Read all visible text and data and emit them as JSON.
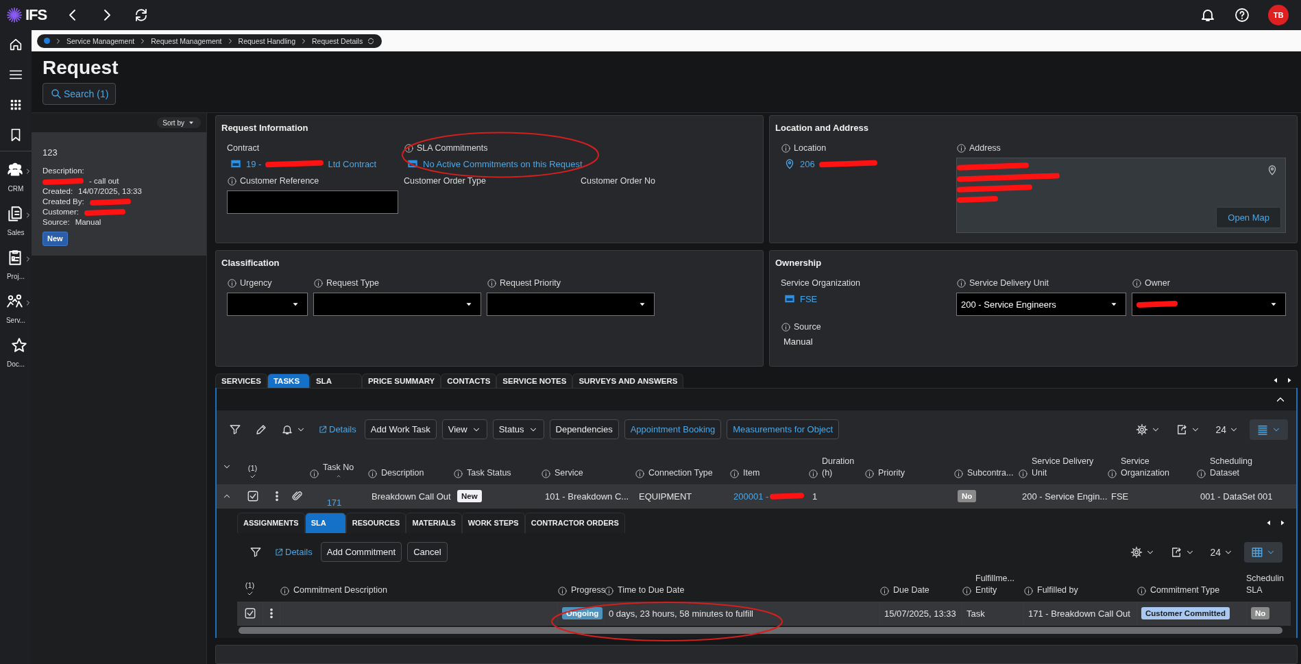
{
  "topbar": {
    "logo": "IFS",
    "avatar": "TB"
  },
  "nav": [
    {
      "kind": "crm",
      "label": "CRM",
      "expandable": true
    },
    {
      "kind": "sales",
      "label": "Sales",
      "expandable": true
    },
    {
      "kind": "proj",
      "label": "Proj...",
      "expandable": true
    },
    {
      "kind": "serv",
      "label": "Serv...",
      "expandable": true
    },
    {
      "kind": "doc",
      "label": "Doc...",
      "expandable": false
    }
  ],
  "breadcrumb": [
    "Service Management",
    "Request Management",
    "Request Handling",
    "Request Details"
  ],
  "title": "Request",
  "search_button": "Search (1)",
  "list": {
    "sort": "Sort by",
    "cards": [
      {
        "selected": true,
        "title": "123",
        "status": "New",
        "lines": [
          {
            "label": "Description:"
          },
          {
            "value": "- call out",
            "redacted": true
          },
          {
            "label": "Created:",
            "value": "14/07/2025, 13:33"
          },
          {
            "label": "Created By:",
            "redacted": true
          },
          {
            "label": "Customer:",
            "redacted": true
          },
          {
            "label": "Source:",
            "value": "Manual"
          }
        ]
      }
    ]
  },
  "panels": [
    {
      "title": "Request Information",
      "rows": [
        [
          {
            "kind": "link",
            "label": "Contract",
            "info": false,
            "parts": [
              "19 -",
              "Ltd Contract"
            ],
            "redacted": true
          },
          {
            "kind": "link",
            "label": "SLA Commitments",
            "info": true,
            "parts": [
              "No Active Commitments on this Request"
            ],
            "redacted": false
          }
        ],
        [
          {
            "kind": "input",
            "label": "Customer Reference",
            "info": true
          },
          {
            "kind": "empty",
            "label": "Customer Order Type",
            "info": false
          },
          {
            "kind": "empty",
            "label": "Customer Order No",
            "info": false
          }
        ]
      ]
    },
    {
      "title": "Location and Address",
      "rows": [
        [
          {
            "kind": "location",
            "label": "Location",
            "info": true,
            "parts": [
              "206"
            ],
            "redacted": true
          },
          {
            "kind": "address",
            "label": "Address",
            "info": true,
            "button": "Open Map",
            "redacted": true
          }
        ]
      ]
    },
    {
      "title": "Classification",
      "rows": [
        [
          {
            "kind": "select",
            "label": "Urgency",
            "info": true
          },
          {
            "kind": "select",
            "label": "Request Type",
            "info": true
          },
          {
            "kind": "select",
            "label": "Request Priority",
            "info": true
          }
        ]
      ]
    },
    {
      "title": "Ownership",
      "rows": [
        [
          {
            "kind": "link",
            "label": "Service Organization",
            "info": false,
            "parts": [
              "FSE"
            ],
            "redacted": false
          },
          {
            "kind": "select",
            "label": "Service Delivery Unit",
            "info": true,
            "value": "200 - Service Engineers"
          },
          {
            "kind": "select",
            "label": "Owner",
            "info": true,
            "redacted": true
          }
        ],
        [
          {
            "kind": "text",
            "label": "Source",
            "info": true,
            "value": "Manual"
          }
        ]
      ]
    }
  ],
  "tabs": [
    {
      "label": "SERVICES",
      "selected": false
    },
    {
      "label": "TASKS",
      "selected": true
    },
    {
      "label": "SLA",
      "selected": false
    },
    {
      "label": "PRICE SUMMARY",
      "selected": false
    },
    {
      "label": "CONTACTS",
      "selected": false
    },
    {
      "label": "SERVICE NOTES",
      "selected": false
    },
    {
      "label": "SURVEYS AND ANSWERS",
      "selected": false
    }
  ],
  "tasks": {
    "toolbar": [
      {
        "kind": "filter"
      },
      {
        "kind": "edit"
      },
      {
        "kind": "notify-menu"
      },
      {
        "kind": "link",
        "label": "Details"
      },
      {
        "kind": "button",
        "label": "Add Work Task"
      },
      {
        "kind": "menu",
        "label": "View"
      },
      {
        "kind": "menu",
        "label": "Status"
      },
      {
        "kind": "button",
        "label": "Dependencies"
      },
      {
        "kind": "button-link",
        "label": "Appointment Booking"
      },
      {
        "kind": "button-link",
        "label": "Measurements for Object"
      }
    ],
    "page_size": "24",
    "select_count": "(1)",
    "columns": [
      {
        "label": "Task No",
        "info": true,
        "sorted": true
      },
      {
        "label": "Description",
        "info": true,
        "sorted": false
      },
      {
        "label": "Task Status",
        "info": true,
        "sorted": false
      },
      {
        "label": "Service",
        "info": true,
        "sorted": false
      },
      {
        "label": "Connection Type",
        "info": true,
        "sorted": false
      },
      {
        "label": "Item",
        "info": true,
        "sorted": false
      },
      {
        "label": "Duration\n(h)",
        "info": true,
        "sorted": false
      },
      {
        "label": "Priority",
        "info": true,
        "sorted": false
      },
      {
        "label": "Subcontra...",
        "info": true,
        "sorted": false
      },
      {
        "label": "Service Delivery\nUnit",
        "info": true,
        "sorted": false
      },
      {
        "label": "Service\nOrganization",
        "info": true,
        "sorted": false
      },
      {
        "label": "Scheduling\nDataset",
        "info": true,
        "sorted": false
      }
    ],
    "rows": [
      {
        "selected": true,
        "expanded": true,
        "cells": [
          {
            "kind": "link",
            "text": "171"
          },
          {
            "kind": "text",
            "text": "Breakdown Call Out"
          },
          {
            "kind": "badge",
            "text": "New",
            "color": "#f2f2f7"
          },
          {
            "kind": "text",
            "text": "101 - Breakdown C..."
          },
          {
            "kind": "text",
            "text": "EQUIPMENT"
          },
          {
            "kind": "link",
            "text": "200001 -",
            "redacted": true
          },
          {
            "kind": "text",
            "text": "1"
          },
          {
            "kind": "text",
            "text": ""
          },
          {
            "kind": "badge",
            "text": "No",
            "color": "#8a8a8a"
          },
          {
            "kind": "text",
            "text": "200 - Service Engin..."
          },
          {
            "kind": "text",
            "text": "FSE"
          },
          {
            "kind": "text",
            "text": "001 - DataSet 001"
          }
        ]
      }
    ]
  },
  "subtabs": [
    {
      "label": "ASSIGNMENTS",
      "selected": false
    },
    {
      "label": "SLA",
      "selected": true
    },
    {
      "label": "RESOURCES",
      "selected": false
    },
    {
      "label": "MATERIALS",
      "selected": false
    },
    {
      "label": "WORK STEPS",
      "selected": false
    },
    {
      "label": "CONTRACTOR ORDERS",
      "selected": false
    }
  ],
  "sla": {
    "toolbar": [
      {
        "kind": "filter"
      },
      {
        "kind": "link",
        "label": "Details"
      },
      {
        "kind": "button",
        "label": "Add Commitment"
      },
      {
        "kind": "button",
        "label": "Cancel"
      }
    ],
    "page_size": "24",
    "select_count": "(1)",
    "columns": [
      {
        "label": "Commitment Description",
        "info": true
      },
      {
        "label": "Progress",
        "info": true
      },
      {
        "label": "Time to Due Date",
        "info": true
      },
      {
        "label": "Due Date",
        "info": true
      },
      {
        "label": "Fulfillme...\nEntity",
        "info": true
      },
      {
        "label": "Fulfilled by",
        "info": true
      },
      {
        "label": "Commitment Type",
        "info": true
      },
      {
        "label": "Schedulin\nSLA",
        "info": false
      }
    ],
    "rows": [
      {
        "selected": true,
        "cells": [
          {
            "kind": "text",
            "text": ""
          },
          {
            "kind": "badge",
            "text": "Ongoing",
            "color": "#4f93bd"
          },
          {
            "kind": "text",
            "text": "0 days, 23 hours, 58 minutes to fulfill"
          },
          {
            "kind": "text",
            "text": "15/07/2025, 13:33"
          },
          {
            "kind": "text",
            "text": "Task"
          },
          {
            "kind": "text",
            "text": "171 - Breakdown Call Out"
          },
          {
            "kind": "badge",
            "text": "Customer Committed",
            "color": "#a9c9f2"
          },
          {
            "kind": "badge",
            "text": "No",
            "color": "#8a8a8a"
          }
        ]
      }
    ]
  }
}
